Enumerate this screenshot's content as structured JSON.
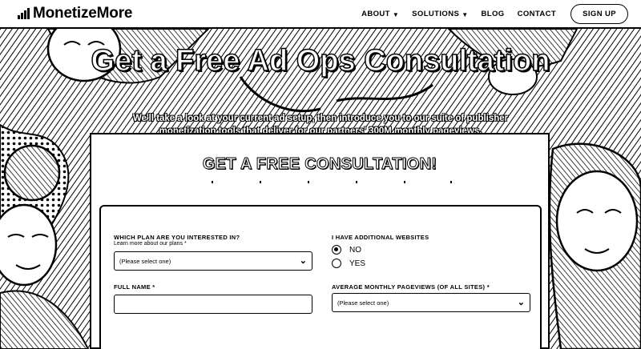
{
  "header": {
    "logo_text": "MonetizeMore",
    "nav": [
      {
        "label": "ABOUT",
        "dropdown": true
      },
      {
        "label": "SOLUTIONS",
        "dropdown": true
      },
      {
        "label": "BLOG",
        "dropdown": false
      },
      {
        "label": "CONTACT",
        "dropdown": false
      }
    ],
    "signup_label": "SIGN UP"
  },
  "hero": {
    "title": "Get a Free Ad Ops Consultation",
    "subtitle": "We'll take a look at your current ad setup, then introduce you to our suite of publisher monetization tools that deliver for our partners' 300M monthly pageviews."
  },
  "form": {
    "title": "GET A FREE CONSULTATION!",
    "plan": {
      "label": "WHICH PLAN ARE YOU INTERESTED IN?",
      "sublabel": "Learn more about our plans *",
      "value": "(Please select one)"
    },
    "additional_websites": {
      "label": "I HAVE ADDITIONAL WEBSITES",
      "options": [
        "NO",
        "YES"
      ],
      "selected": "NO"
    },
    "full_name": {
      "label": "FULL NAME *",
      "value": ""
    },
    "pageviews": {
      "label": "AVERAGE MONTHLY PAGEVIEWS (OF ALL SITES) *",
      "value": "(Please select one)"
    }
  },
  "icons": {
    "dropdown": "chevron-down-icon",
    "logo": "bar-chart-logo-icon"
  }
}
